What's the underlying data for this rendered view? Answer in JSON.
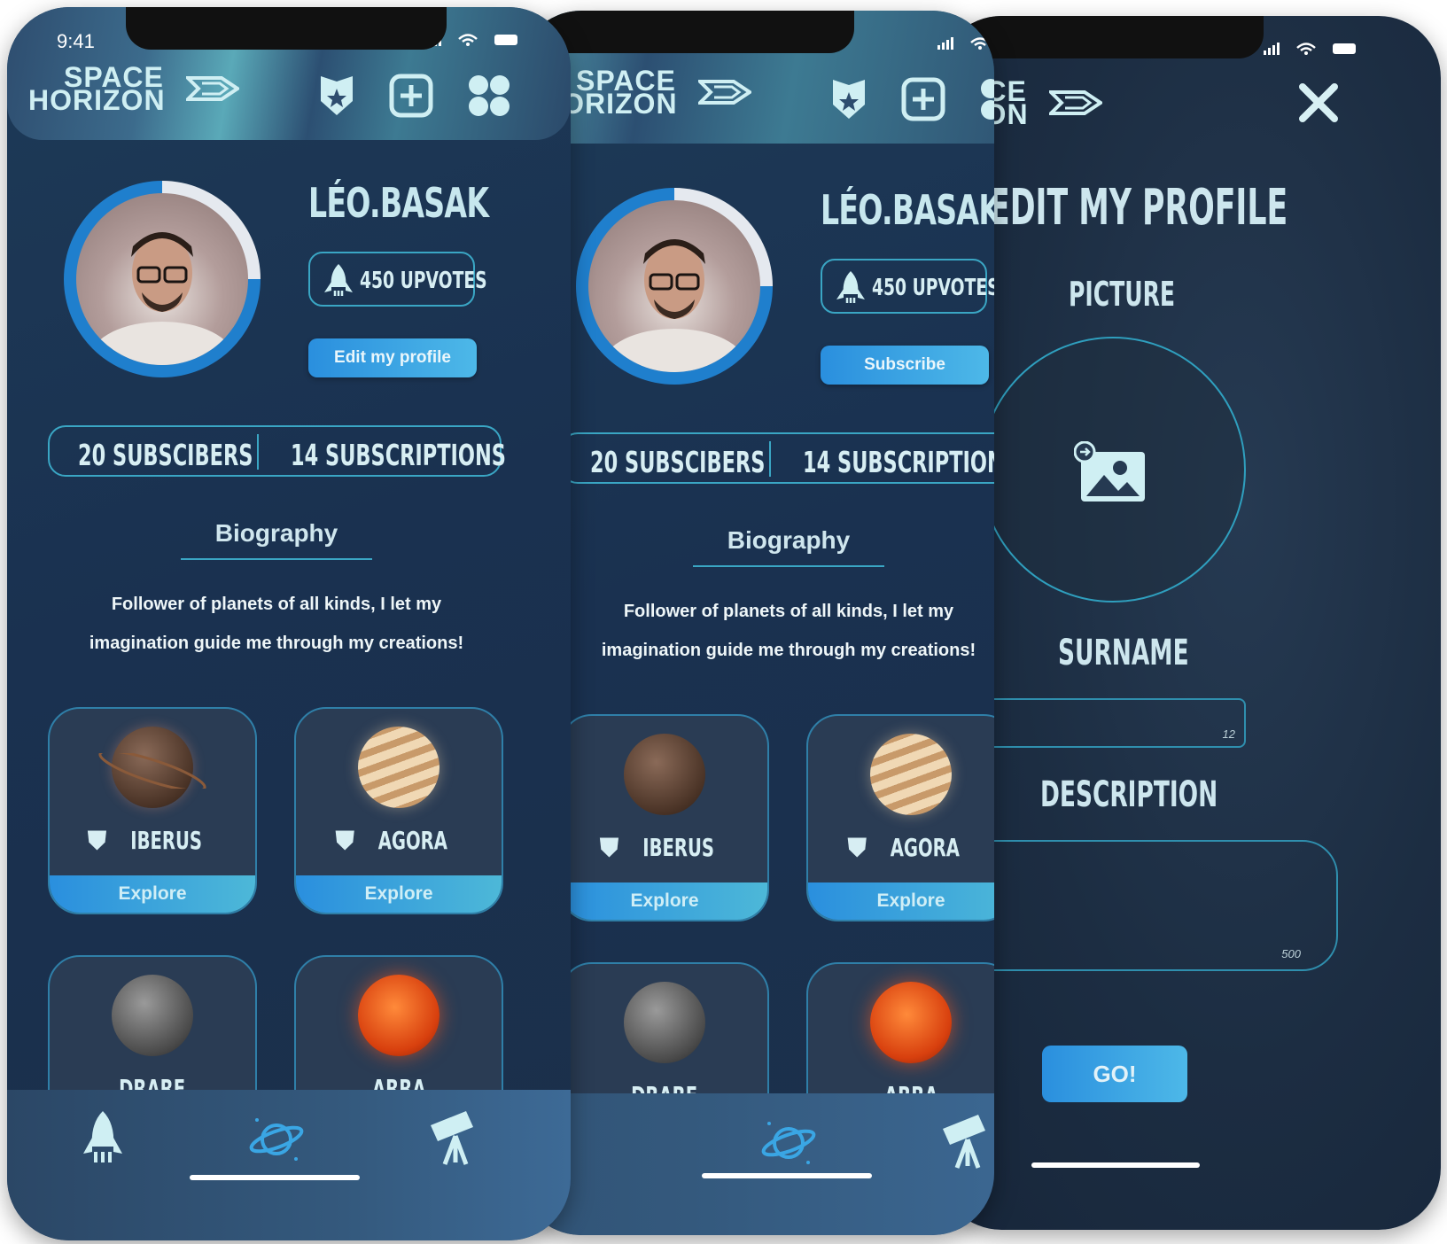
{
  "status": {
    "time": "9:41"
  },
  "brand": {
    "line1": "SPACE",
    "line2": "HORIZON"
  },
  "profile": {
    "username": "LÉO.BASAK",
    "upvotes": "450 UPVOTES",
    "edit_button": "Edit my profile",
    "subscribe_button": "Subscribe",
    "subscribers": "20 SUBSCIBERS",
    "subscriptions": "14 SUBSCRIPTIONS",
    "bio_title": "Biography",
    "bio_line1": "Follower of planets of all kinds, I let my",
    "bio_line2": "imagination guide me through my creations!"
  },
  "planets": [
    {
      "name": "IBERUS",
      "action": "Explore",
      "color": "#6a4a3a"
    },
    {
      "name": "AGORA",
      "action": "Explore",
      "color": "#d8b48a"
    },
    {
      "name": "DRARE",
      "action": "",
      "color": "#5a5a5a"
    },
    {
      "name": "ARRA",
      "action": "",
      "color": "#e0471a"
    }
  ],
  "edit_profile": {
    "title": "EDIT MY PROFILE",
    "picture_label": "PICTURE",
    "surname_label": "SURNAME",
    "surname_counter": "12",
    "description_label": "DESCRIPTION",
    "description_counter": "500",
    "go_button": "GO!"
  },
  "icons": [
    "shield-star-icon",
    "add-square-icon",
    "grid-icon",
    "close-icon",
    "rocket-icon",
    "planet-icon",
    "telescope-icon",
    "image-upload-icon"
  ],
  "colors": {
    "accent": "#3aa6c4",
    "button": "#2a8fde",
    "text": "#d7eef3"
  }
}
